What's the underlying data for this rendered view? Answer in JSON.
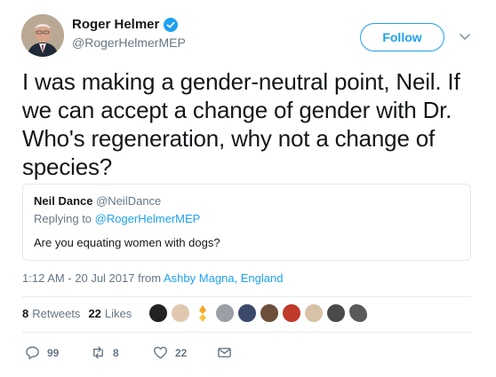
{
  "author": {
    "name": "Roger Helmer",
    "handle": "@RogerHelmerMEP",
    "verified": true
  },
  "follow_label": "Follow",
  "tweet_text": "I was making a gender-neutral point, Neil.  If we can accept a change of gender with Dr. Who's regeneration, why not a change of species?",
  "quoted": {
    "name": "Neil Dance",
    "handle": "@NeilDance",
    "replying_prefix": "Replying to",
    "replying_handle": "@RogerHelmerMEP",
    "text": "Are you equating women with dogs?"
  },
  "meta": {
    "time": "1:12 AM - 20 Jul 2017",
    "from": "from",
    "location": "Ashby Magna, England"
  },
  "stats": {
    "retweets_count": "8",
    "retweets_label": "Retweets",
    "likes_count": "22",
    "likes_label": "Likes"
  },
  "likers": [
    "liker-avatar",
    "liker-avatar",
    "liker-avatar",
    "liker-avatar",
    "liker-avatar",
    "liker-avatar",
    "liker-avatar",
    "liker-avatar",
    "liker-avatar",
    "liker-avatar"
  ],
  "actions": {
    "reply_count": "99",
    "retweet_count": "8",
    "like_count": "22"
  },
  "colors": {
    "accent": "#1da1f2",
    "secondary_text": "#657786",
    "border": "#e1e8ed"
  }
}
